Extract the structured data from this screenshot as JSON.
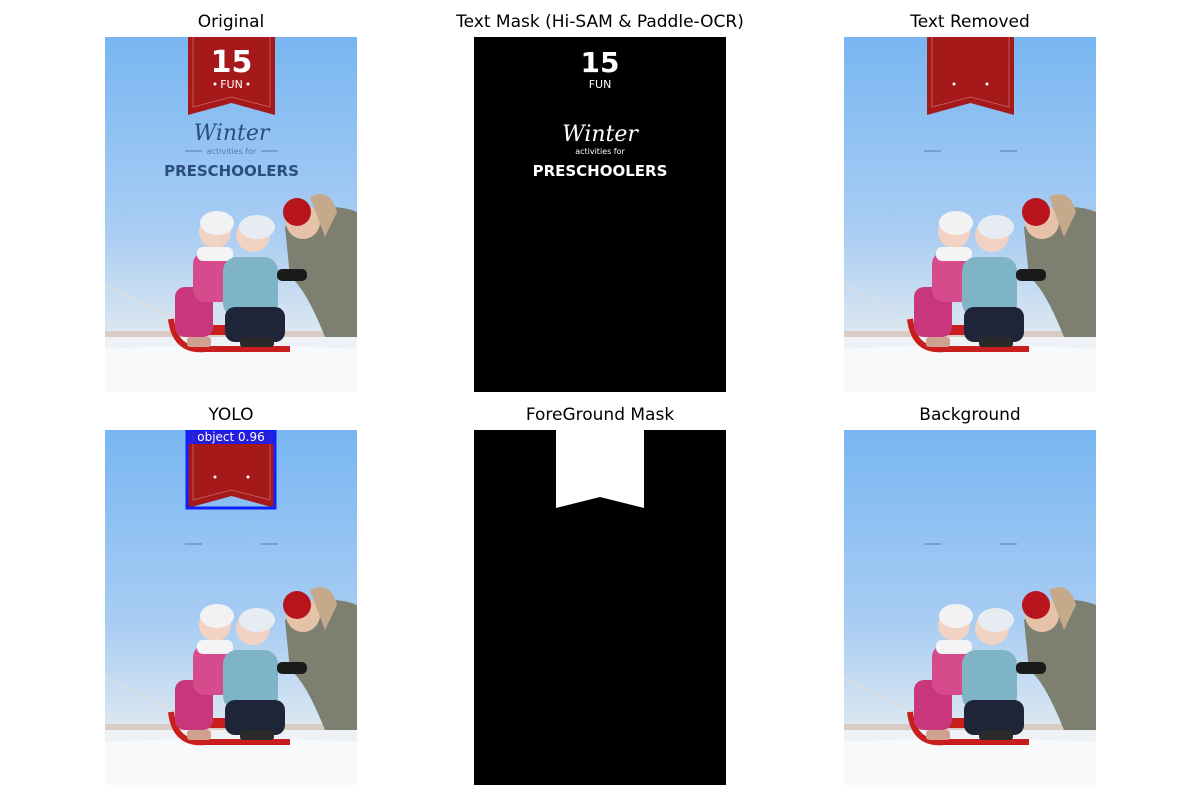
{
  "panels": {
    "original": {
      "title": "Original"
    },
    "text_mask": {
      "title": "Text Mask (Hi-SAM & Paddle-OCR)"
    },
    "text_removed": {
      "title": "Text Removed"
    },
    "yolo": {
      "title": "YOLO"
    },
    "foreground_mask": {
      "title": "ForeGround Mask"
    },
    "background": {
      "title": "Background"
    }
  },
  "poster": {
    "number": "15",
    "fun": "FUN",
    "script": "Winter",
    "subtitle": "activities for",
    "headline": "PRESCHOOLERS"
  },
  "mask_text": {
    "number": "15",
    "fun": "FUN",
    "script": "Winter",
    "subtitle": "activities for",
    "headline": "PRESCHOOLERS"
  },
  "yolo": {
    "label": "object 0.96",
    "box_color": "#1020ff"
  },
  "colors": {
    "banner": "#a5191b",
    "sky_top": "#78b6f2",
    "sky_bottom": "#cfe3f5",
    "headline": "#2b4e7e"
  }
}
